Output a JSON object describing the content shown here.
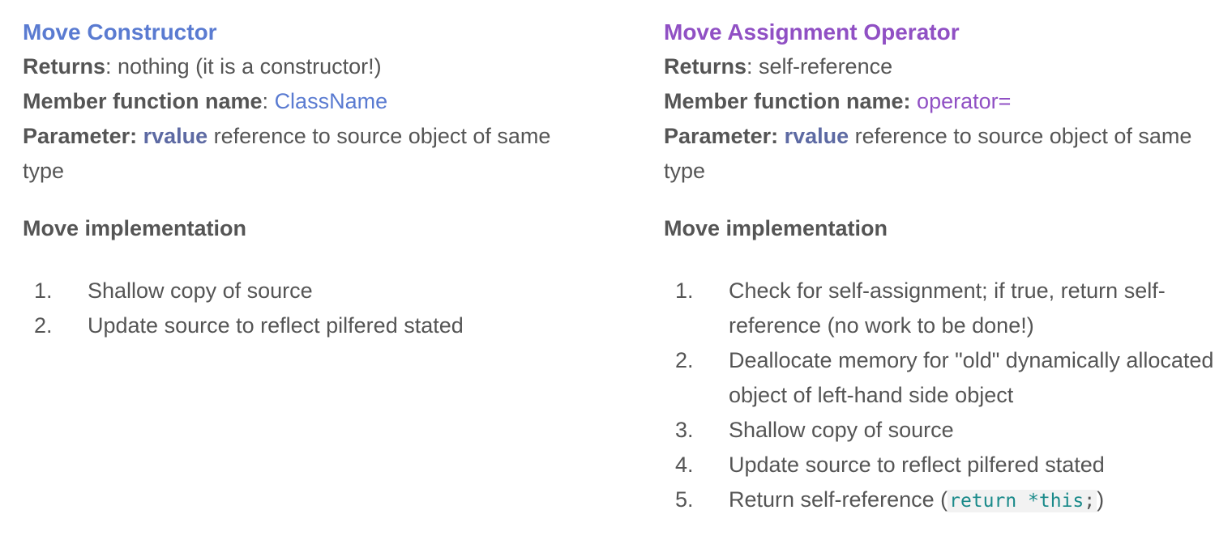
{
  "left": {
    "title": "Move Constructor",
    "title_color": "#5a7bd1",
    "returns_label": "Returns",
    "returns_sep": ": ",
    "returns_value": "nothing (it is a constructor!)",
    "member_label": "Member function name",
    "member_sep": ": ",
    "member_value": "ClassName",
    "param_label": "Parameter",
    "param_sep": ": ",
    "param_rvalue": "rvalue",
    "param_rest": " reference to source object of same type",
    "impl_title": "Move implementation",
    "steps": [
      {
        "num": "1.",
        "text": "Shallow copy of source"
      },
      {
        "num": "2.",
        "text": "Update source to reflect pilfered stated"
      }
    ]
  },
  "right": {
    "title": "Move Assignment Operator",
    "title_color": "#9050c4",
    "returns_label": "Returns",
    "returns_sep": ": ",
    "returns_value": "self-reference",
    "member_label": "Member function name:",
    "member_sep": " ",
    "member_value": "operator=",
    "param_label": "Parameter:",
    "param_sep": " ",
    "param_rvalue": "rvalue",
    "param_rest": " reference to source object of same type",
    "impl_title": "Move implementation",
    "steps": [
      {
        "num": "1.",
        "text": "Check for self-assignment; if true, return self-reference (no work to be done!)"
      },
      {
        "num": "2.",
        "text": "Deallocate memory for \"old\" dynamically allocated object of left-hand side object"
      },
      {
        "num": "3.",
        "text": "Shallow copy of source"
      },
      {
        "num": "4.",
        "text": "Update source to reflect pilfered stated"
      },
      {
        "num": "5.",
        "text": "Return self-reference (",
        "code": "return *this",
        "code_punct": ";",
        "text_after": ")"
      }
    ]
  },
  "colors": {
    "body_text": "#555555",
    "rvalue": "#5d6aa3",
    "code": "#1a8a8a",
    "code_bg": "#f2f2f2"
  }
}
